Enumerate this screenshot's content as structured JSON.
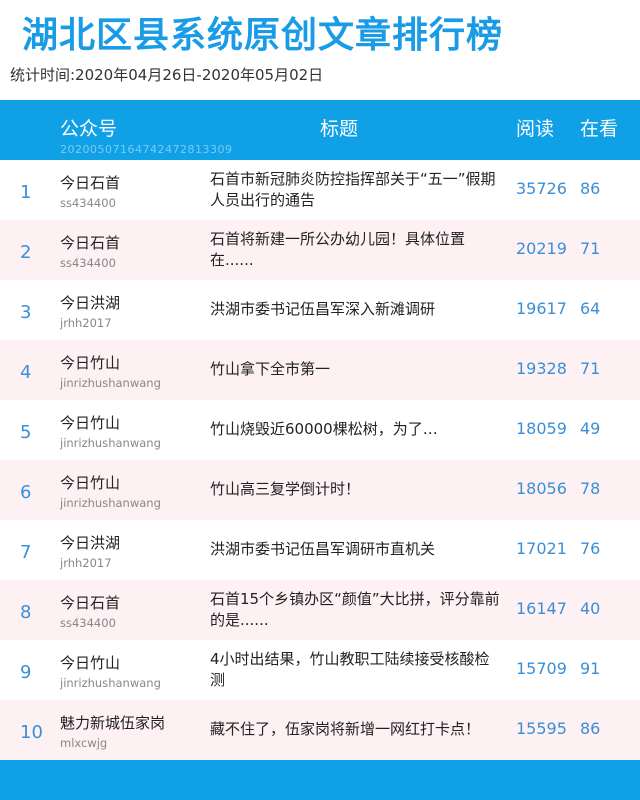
{
  "page": {
    "title": "湖北区县系统原创文章排行榜",
    "period": "统计时间:2020年04月26日-2020年05月02日"
  },
  "colors": {
    "accent": "#0fa0e6",
    "number": "#3a8fd8",
    "alt_row": "#fdf1f3"
  },
  "table": {
    "headers": {
      "account": "公众号",
      "title": "标题",
      "reads": "阅读",
      "watching": "在看"
    },
    "header_id": "20200507164742472813309",
    "rows": [
      {
        "rank": "1",
        "account": "今日石首",
        "account_id": "ss434400",
        "title": "石首市新冠肺炎防控指挥部关于“五一”假期人员出行的通告",
        "reads": "35726",
        "watching": "86"
      },
      {
        "rank": "2",
        "account": "今日石首",
        "account_id": "ss434400",
        "title": "石首将新建一所公办幼儿园！具体位置在......",
        "reads": "20219",
        "watching": "71"
      },
      {
        "rank": "3",
        "account": "今日洪湖",
        "account_id": "jrhh2017",
        "title": "洪湖市委书记伍昌军深入新滩调研",
        "reads": "19617",
        "watching": "64"
      },
      {
        "rank": "4",
        "account": "今日竹山",
        "account_id": "jinrizhushanwang",
        "title": "竹山拿下全市第一",
        "reads": "19328",
        "watching": "71"
      },
      {
        "rank": "5",
        "account": "今日竹山",
        "account_id": "jinrizhushanwang",
        "title": "竹山烧毁近60000棵松树，为了…",
        "reads": "18059",
        "watching": "49"
      },
      {
        "rank": "6",
        "account": "今日竹山",
        "account_id": "jinrizhushanwang",
        "title": "竹山高三复学倒计时！",
        "reads": "18056",
        "watching": "78"
      },
      {
        "rank": "7",
        "account": "今日洪湖",
        "account_id": "jrhh2017",
        "title": "洪湖市委书记伍昌军调研市直机关",
        "reads": "17021",
        "watching": "76"
      },
      {
        "rank": "8",
        "account": "今日石首",
        "account_id": "ss434400",
        "title": "石首15个乡镇办区“颜值”大比拼，评分靠前的是......",
        "reads": "16147",
        "watching": "40"
      },
      {
        "rank": "9",
        "account": "今日竹山",
        "account_id": "jinrizhushanwang",
        "title": "4小时出结果，竹山教职工陆续接受核酸检测",
        "reads": "15709",
        "watching": "91"
      },
      {
        "rank": "10",
        "account": "魅力新城伍家岗",
        "account_id": "mlxcwjg",
        "title": "藏不住了，伍家岗将新增一网红打卡点！",
        "reads": "15595",
        "watching": "86"
      }
    ]
  }
}
